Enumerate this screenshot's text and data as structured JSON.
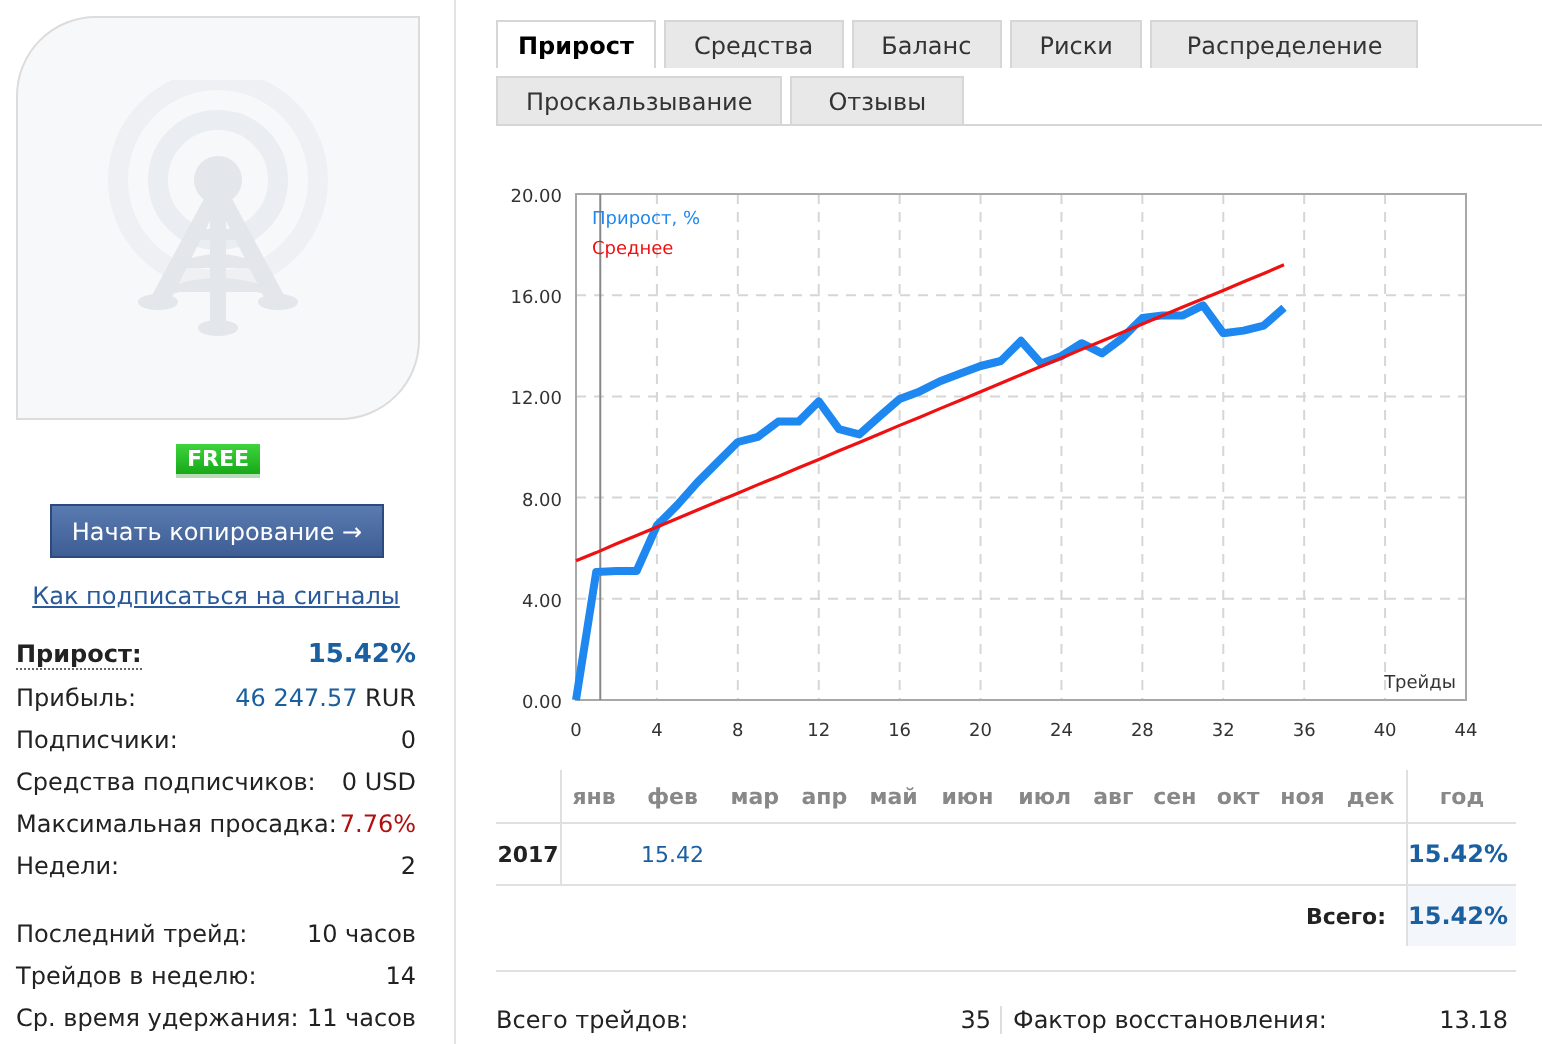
{
  "sidebar": {
    "badge": "FREE",
    "copy_button": "Начать копирование →",
    "help_link": "Как подписаться на сигналы",
    "stats": [
      {
        "label": "Прирост:",
        "value": "15.42%",
        "kind": "highlight"
      },
      {
        "label": "Прибыль:",
        "value": "46 247.57",
        "unit": "RUR",
        "kind": "money"
      },
      {
        "label": "Подписчики:",
        "value": "0",
        "kind": "plain"
      },
      {
        "label": "Средства подписчиков:",
        "value": "0 USD",
        "kind": "plain"
      },
      {
        "label": "Максимальная просадка:",
        "value": "7.76%",
        "kind": "danger"
      },
      {
        "label": "Недели:",
        "value": "2",
        "kind": "plain"
      }
    ],
    "stats_2": [
      {
        "label": "Последний трейд:",
        "value": "10 часов",
        "kind": "plain"
      },
      {
        "label": "Трейдов в неделю:",
        "value": "14",
        "kind": "plain"
      },
      {
        "label": "Ср. время удержания:",
        "value": "11 часов",
        "kind": "plain"
      }
    ]
  },
  "tabs": [
    {
      "label": "Прирост",
      "selected": true
    },
    {
      "label": "Средства",
      "selected": false
    },
    {
      "label": "Баланс",
      "selected": false
    },
    {
      "label": "Риски",
      "selected": false
    },
    {
      "label": "Распределение",
      "selected": false
    },
    {
      "label": "Проскальзывание",
      "selected": false
    },
    {
      "label": "Отзывы",
      "selected": false
    }
  ],
  "chart_data": {
    "type": "line",
    "xlabel": "Трейды",
    "x": [
      0,
      1,
      2,
      3,
      4,
      5,
      6,
      7,
      8,
      9,
      10,
      11,
      12,
      13,
      14,
      15,
      16,
      17,
      18,
      19,
      20,
      21,
      22,
      23,
      24,
      25,
      26,
      27,
      28,
      29,
      30,
      31,
      32,
      33,
      34,
      35
    ],
    "series": [
      {
        "name": "Прирост, %",
        "color": "#1e88f0",
        "values": [
          0,
          5.06,
          5.1,
          5.1,
          6.9,
          7.7,
          8.6,
          9.4,
          10.2,
          10.4,
          11.0,
          11.0,
          11.8,
          10.7,
          10.5,
          11.2,
          11.9,
          12.2,
          12.6,
          12.9,
          13.2,
          13.4,
          14.2,
          13.3,
          13.6,
          14.1,
          13.7,
          14.3,
          15.1,
          15.2,
          15.2,
          15.6,
          14.5,
          14.6,
          14.8,
          15.5
        ]
      },
      {
        "name": "Среднее",
        "color": "#ee1111",
        "values": [
          5.5,
          5.83,
          6.17,
          6.5,
          6.84,
          7.17,
          7.51,
          7.84,
          8.17,
          8.51,
          8.84,
          9.18,
          9.51,
          9.85,
          10.18,
          10.51,
          10.85,
          11.18,
          11.52,
          11.85,
          12.18,
          12.52,
          12.85,
          13.19,
          13.52,
          13.86,
          14.19,
          14.52,
          14.86,
          15.19,
          15.53,
          15.86,
          16.19,
          16.53,
          16.86,
          17.2
        ]
      }
    ],
    "xlim": [
      0,
      44
    ],
    "ylim": [
      0,
      20
    ],
    "grid": true,
    "xticks": [
      0,
      4,
      8,
      12,
      16,
      20,
      24,
      28,
      32,
      36,
      40,
      44
    ],
    "yticks": [
      {
        "value": 0,
        "label": "0.00"
      },
      {
        "value": 4,
        "label": "4.00"
      },
      {
        "value": 8,
        "label": "8.00"
      },
      {
        "value": 12,
        "label": "12.00"
      },
      {
        "value": 16,
        "label": "16.00"
      },
      {
        "value": 20,
        "label": "20.00"
      }
    ]
  },
  "monthly_table": {
    "columns": [
      "янв",
      "фев",
      "мар",
      "апр",
      "май",
      "июн",
      "июл",
      "авг",
      "сен",
      "окт",
      "ноя",
      "дек"
    ],
    "year_column": "год",
    "rows": [
      {
        "year": "2017",
        "cells": [
          {
            "kind": "blank"
          },
          {
            "kind": "value",
            "text": "15.42"
          },
          {
            "kind": "blank"
          },
          {
            "kind": "blank"
          },
          {
            "kind": "blank"
          },
          {
            "kind": "blank"
          },
          {
            "kind": "blank"
          },
          {
            "kind": "blank"
          },
          {
            "kind": "blank"
          },
          {
            "kind": "blank"
          },
          {
            "kind": "blank"
          },
          {
            "kind": "blank"
          }
        ],
        "total": "15.42%"
      }
    ],
    "total_row": {
      "label": "Всего:",
      "value": "15.42%"
    }
  },
  "summary": [
    {
      "label": "Всего трейдов:",
      "value": "35"
    },
    {
      "label": "Фактор восстановления:",
      "value": "13.18"
    }
  ]
}
